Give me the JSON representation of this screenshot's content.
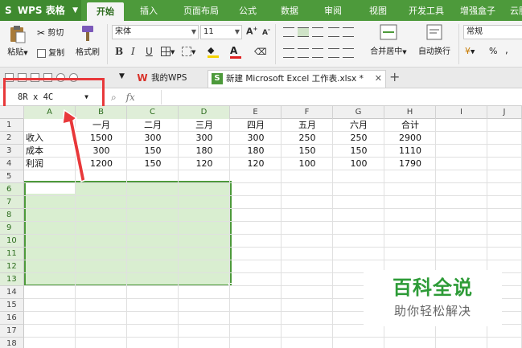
{
  "app": {
    "name": "WPS 表格",
    "logo": "S"
  },
  "ribbon_tabs": [
    "开始",
    "插入",
    "页面布局",
    "公式",
    "数据",
    "审阅",
    "视图",
    "开发工具",
    "增强盒子",
    "云服"
  ],
  "active_tab": "开始",
  "clipboard": {
    "paste": "粘贴",
    "cut": "剪切",
    "copy": "复制",
    "format_painter": "格式刷"
  },
  "font": {
    "name": "宋体",
    "size": "11",
    "bold": "B",
    "italic": "I",
    "underline": "U"
  },
  "alignment": {
    "merge_center": "合并居中",
    "wrap_text": "自动换行"
  },
  "number": {
    "format": "常规",
    "percent": "%",
    "comma": ","
  },
  "documents": [
    {
      "label": "我的WPS",
      "icon": "W"
    },
    {
      "label": "新建 Microsoft Excel 工作表.xlsx *",
      "icon": "S"
    }
  ],
  "name_box": "8R x 4C",
  "formula_fx": "fx",
  "columns": [
    "A",
    "B",
    "C",
    "D",
    "E",
    "F",
    "G",
    "H",
    "I",
    "J"
  ],
  "rows": [
    "1",
    "2",
    "3",
    "4",
    "5",
    "6",
    "7",
    "8",
    "9",
    "10",
    "11",
    "12",
    "13",
    "14",
    "15",
    "16",
    "17",
    "18"
  ],
  "table": {
    "header": [
      "",
      "一月",
      "二月",
      "三月",
      "四月",
      "五月",
      "六月",
      "合计"
    ],
    "rows": [
      [
        "收入",
        "1500",
        "300",
        "300",
        "300",
        "250",
        "250",
        "2900"
      ],
      [
        "成本",
        "300",
        "150",
        "180",
        "180",
        "150",
        "150",
        "1110"
      ],
      [
        "利润",
        "1200",
        "150",
        "120",
        "120",
        "100",
        "100",
        "1790"
      ]
    ]
  },
  "watermark": {
    "title": "百科全说",
    "subtitle": "助你轻松解决"
  },
  "colors": {
    "accent": "#4d9a3b",
    "highlight": "#e8383a",
    "selection": "#91cd78"
  }
}
